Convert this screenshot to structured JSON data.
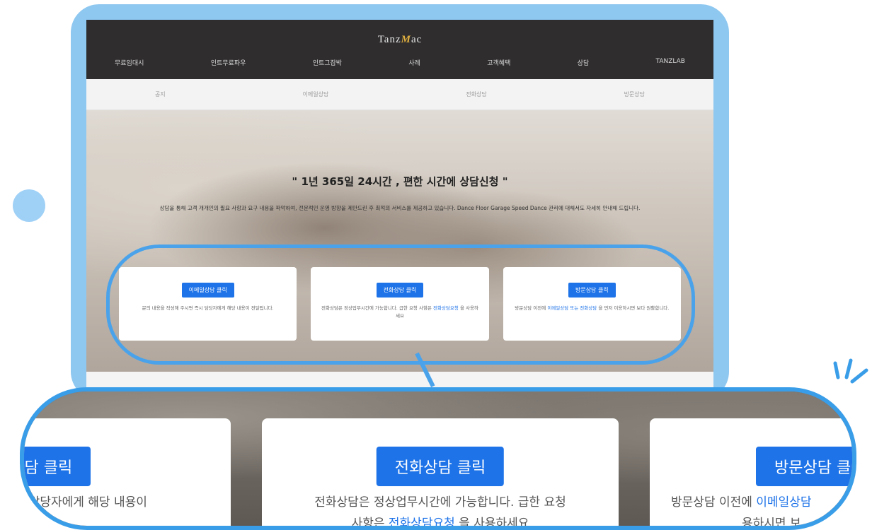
{
  "header": {
    "logo_pre": "Tanz",
    "logo_mark": "M",
    "logo_post": "ac",
    "nav": [
      "무료임대시",
      "인트무료파우",
      "인트그잡박",
      "사례",
      "고객혜택",
      "상담",
      "TANZLAB"
    ]
  },
  "subnav": [
    "공지",
    "이메일상담",
    "전화상담",
    "방문상담"
  ],
  "hero": {
    "title": "\" 1년 365일 24시간 , 편한 시간에 상담신청 \"",
    "description": "상담을 통해 고객 개개인의 필요 사항과 요구 내용을 파악하여, 전문적인 운영 방향을 제안드린 후 최적의 서비스를 제공하고 있습니다. Dance Floor Garage Speed Dance 관리에 대해서도 자세히 안내해 드립니다."
  },
  "cards": [
    {
      "button": "이메일상담 클릭",
      "text": "문의 내용을 작성해 주시면 즉시 담당자에게 해당 내용이 전달됩니다.",
      "link": ""
    },
    {
      "button": "전화상담 클릭",
      "text_before": "전화상담은 정상업무시간에 가능합니다. 급한 요청 사항은",
      "link": "전화상담요청",
      "text_after": "을 사용하세요"
    },
    {
      "button": "방문상담 클릭",
      "text_before": "방문상담 이전에",
      "link": "이메일상담 또는 전화상담",
      "text_after": "을 먼저 이용하시면 보다 원활합니다."
    }
  ],
  "zoom": {
    "card1_button": "일상담 클릭",
    "card1_text1": "즉시 담당자에게 해당 내용이",
    "card1_text2": "니다.",
    "card2_button": "전화상담 클릭",
    "card2_text1": "전화상담은 정상업무시간에 가능합니다. 급한 요청",
    "card2_text2_before": "사항은 ",
    "card2_link": "전화상담요청",
    "card2_text2_after": " 을 사용하세요",
    "card3_button": "방문상담 클",
    "card3_text1_before": "방문상담 이전에 ",
    "card3_link": "이메일상담",
    "card3_text2": "용하시면 보"
  },
  "colors": {
    "accent": "#1e73e8",
    "highlight": "#3a9de8",
    "topbar": "#2f2d2d"
  }
}
